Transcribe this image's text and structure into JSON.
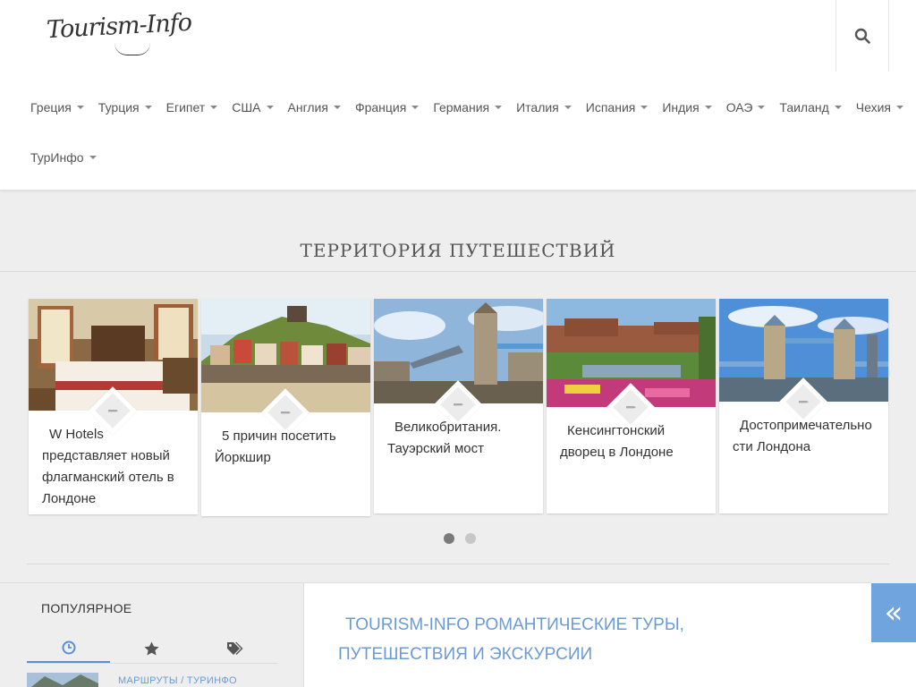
{
  "header": {
    "logo_text": "Tourism-Info",
    "search_icon": "search-icon"
  },
  "nav": {
    "row1": [
      "Греция",
      "Турция",
      "Египет",
      "США",
      "Англия",
      "Франция",
      "Германия",
      "Италия",
      "Испания",
      "Индия",
      "ОАЭ",
      "Таиланд",
      "Чехия"
    ],
    "row2": [
      "ТурИнфо"
    ]
  },
  "section": {
    "title": "ТЕРРИТОРИЯ ПУТЕШЕСТВИЙ"
  },
  "cards": [
    {
      "title": "W Hotels представляет новый флагманский отель в Лондоне",
      "image": "hotel-room-photo"
    },
    {
      "title": "5 причин посетить Йоркшир",
      "image": "yorkshire-town-photo"
    },
    {
      "title": "Великобритания. Тауэрский мост",
      "image": "tower-bridge-photo"
    },
    {
      "title": "Кенсингтонский дворец в Лондоне",
      "image": "kensington-palace-photo"
    },
    {
      "title": "Достопримечательности Лондона",
      "image": "london-bridge-photo"
    }
  ],
  "slider": {
    "pages": 2,
    "active": 1
  },
  "sidebar": {
    "heading": "ПОПУЛЯРНОЕ",
    "tabs": [
      "clock-icon",
      "star-icon",
      "tags-icon"
    ],
    "active_tab": 0,
    "first_item_category": "МАРШРУТЫ / ТУРИНФО"
  },
  "main": {
    "title": "TOURISM-INFO РОМАНТИЧЕСКИЕ ТУРЫ, ПУТЕШЕСТВИЯ И ЭКСКУРСИИ"
  },
  "toggle": {
    "icon": "double-chevron-left-icon",
    "color": "#6fa4de"
  },
  "colors": {
    "accent": "#6a9bd6",
    "background": "#eeeeee"
  }
}
